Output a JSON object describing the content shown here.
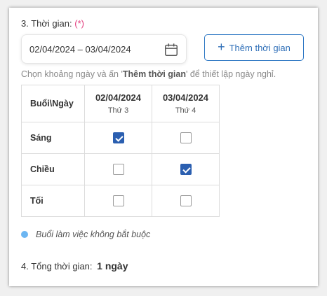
{
  "section": {
    "title": "3. Thời gian:",
    "required_mark": "(*)"
  },
  "date_range": {
    "value": "02/04/2024 – 03/04/2024",
    "icon": "calendar-icon"
  },
  "add_button": {
    "icon": "plus-icon",
    "label": "Thêm thời gian"
  },
  "hint": {
    "before": "Chọn khoảng ngày và ấn '",
    "bold": "Thêm thời gian",
    "after": "' để thiết lập ngày nghỉ."
  },
  "table": {
    "corner_header": "Buổi\\Ngày",
    "days": [
      {
        "date": "02/04/2024",
        "weekday": "Thứ 3"
      },
      {
        "date": "03/04/2024",
        "weekday": "Thứ 4"
      }
    ],
    "rows": [
      {
        "label": "Sáng",
        "checked": [
          true,
          false
        ]
      },
      {
        "label": "Chiều",
        "checked": [
          false,
          true
        ]
      },
      {
        "label": "Tối",
        "checked": [
          false,
          false
        ]
      }
    ]
  },
  "legend": {
    "text": "Buổi làm việc không bắt buộc",
    "dot_color": "#6cb6f2"
  },
  "total": {
    "label": "4. Tổng thời gian:",
    "value": "1 ngày"
  },
  "colors": {
    "accent": "#2f78c4",
    "checkbox_checked": "#2b5fb0",
    "required": "#e23c7d"
  }
}
